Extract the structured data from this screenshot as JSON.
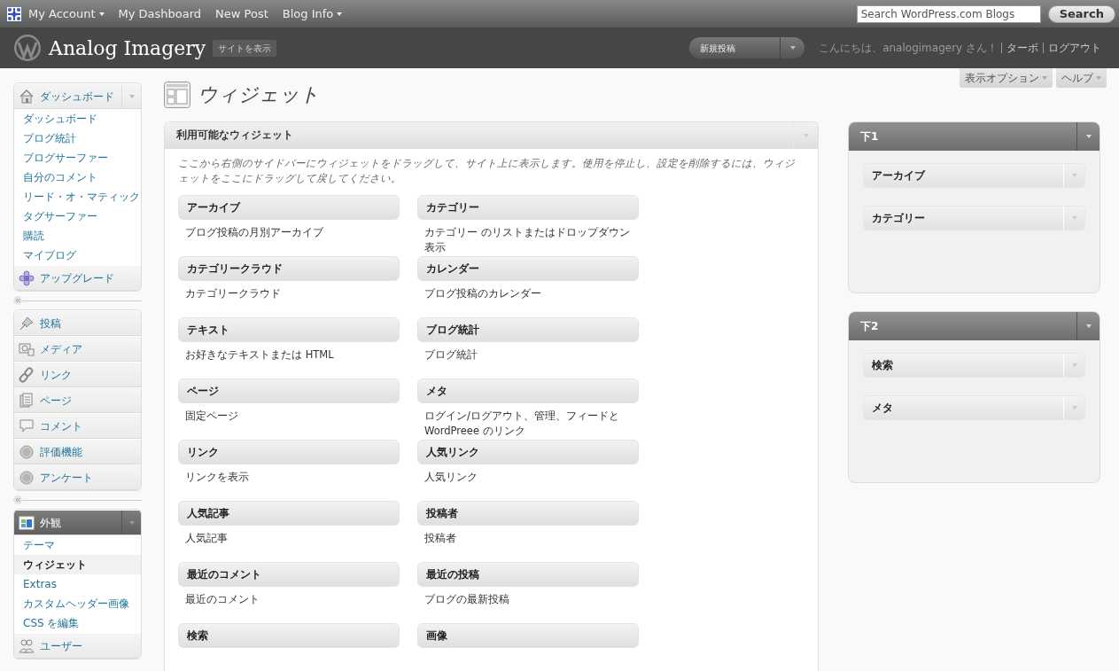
{
  "admin_bar": {
    "items": [
      {
        "label": "My Account",
        "has_menu": true
      },
      {
        "label": "My Dashboard",
        "has_menu": false
      },
      {
        "label": "New Post",
        "has_menu": false
      },
      {
        "label": "Blog Info",
        "has_menu": true
      }
    ],
    "search": {
      "placeholder": "Search WordPress.com Blogs",
      "button": "Search"
    }
  },
  "header": {
    "site_title": "Analog Imagery",
    "view_site": "サイトを表示",
    "new_post_dropdown": "新規投稿",
    "greeting": "こんにちは、analogimagery さん！",
    "links": [
      "ターボ",
      "ログアウト"
    ]
  },
  "screen_meta": [
    "表示オプション",
    "ヘルプ"
  ],
  "menu_groups": [
    {
      "items": [
        {
          "label": "ダッシュボード",
          "current": false,
          "expanded": true,
          "children": [
            {
              "label": "ダッシュボード",
              "selected": false
            },
            {
              "label": "ブログ統計",
              "selected": false
            },
            {
              "label": "ブログサーファー",
              "selected": false
            },
            {
              "label": "自分のコメント",
              "selected": false
            },
            {
              "label": "リード・オ・マティック",
              "selected": false
            },
            {
              "label": "タグサーファー",
              "selected": false
            },
            {
              "label": "購読",
              "selected": false
            },
            {
              "label": "マイブログ",
              "selected": false
            }
          ]
        },
        {
          "label": "アップグレード",
          "current": false,
          "expanded": false
        }
      ]
    },
    {
      "items": [
        {
          "label": "投稿",
          "current": false,
          "expanded": false
        },
        {
          "label": "メディア",
          "current": false,
          "expanded": false
        },
        {
          "label": "リンク",
          "current": false,
          "expanded": false
        },
        {
          "label": "ページ",
          "current": false,
          "expanded": false
        },
        {
          "label": "コメント",
          "current": false,
          "expanded": false
        },
        {
          "label": "評価機能",
          "current": false,
          "expanded": false
        },
        {
          "label": "アンケート",
          "current": false,
          "expanded": false
        }
      ]
    },
    {
      "items": [
        {
          "label": "外観",
          "current": true,
          "expanded": true,
          "children": [
            {
              "label": "テーマ",
              "selected": false
            },
            {
              "label": "ウィジェット",
              "selected": true
            },
            {
              "label": "Extras",
              "selected": false
            },
            {
              "label": "カスタムヘッダー画像",
              "selected": false
            },
            {
              "label": "CSS を編集",
              "selected": false
            }
          ]
        },
        {
          "label": "ユーザー",
          "current": false,
          "expanded": false
        }
      ]
    }
  ],
  "page_title": "ウィジェット",
  "available_widgets": {
    "title": "利用可能なウィジェット",
    "description": "ここから右側のサイドバーにウィジェットをドラッグして、サイト上に表示します。使用を停止し、設定を削除するには、ウィジェットをここにドラッグして戻してください。",
    "widgets": [
      {
        "title": "アーカイブ",
        "description": "ブログ投稿の月別アーカイブ"
      },
      {
        "title": "カテゴリー",
        "description": "カテゴリー のリストまたはドロップダウン表示"
      },
      {
        "title": "カテゴリークラウド",
        "description": "カテゴリークラウド"
      },
      {
        "title": "カレンダー",
        "description": "ブログ投稿のカレンダー"
      },
      {
        "title": "テキスト",
        "description": "お好きなテキストまたは HTML"
      },
      {
        "title": "ブログ統計",
        "description": "ブログ統計"
      },
      {
        "title": "ページ",
        "description": "固定ページ"
      },
      {
        "title": "メタ",
        "description": "ログイン/ログアウト、管理、フィードと WordPreee のリンク"
      },
      {
        "title": "リンク",
        "description": "リンクを表示"
      },
      {
        "title": "人気リンク",
        "description": "人気リンク"
      },
      {
        "title": "人気記事",
        "description": "人気記事"
      },
      {
        "title": "投稿者",
        "description": "投稿者"
      },
      {
        "title": "最近のコメント",
        "description": "最近のコメント"
      },
      {
        "title": "最近の投稿",
        "description": "ブログの最新投稿"
      },
      {
        "title": "検索"
      },
      {
        "title": "画像"
      }
    ]
  },
  "sidebars": [
    {
      "title": "下1",
      "widgets": [
        "アーカイブ",
        "カテゴリー"
      ]
    },
    {
      "title": "下2",
      "widgets": [
        "検索",
        "メタ"
      ]
    }
  ]
}
